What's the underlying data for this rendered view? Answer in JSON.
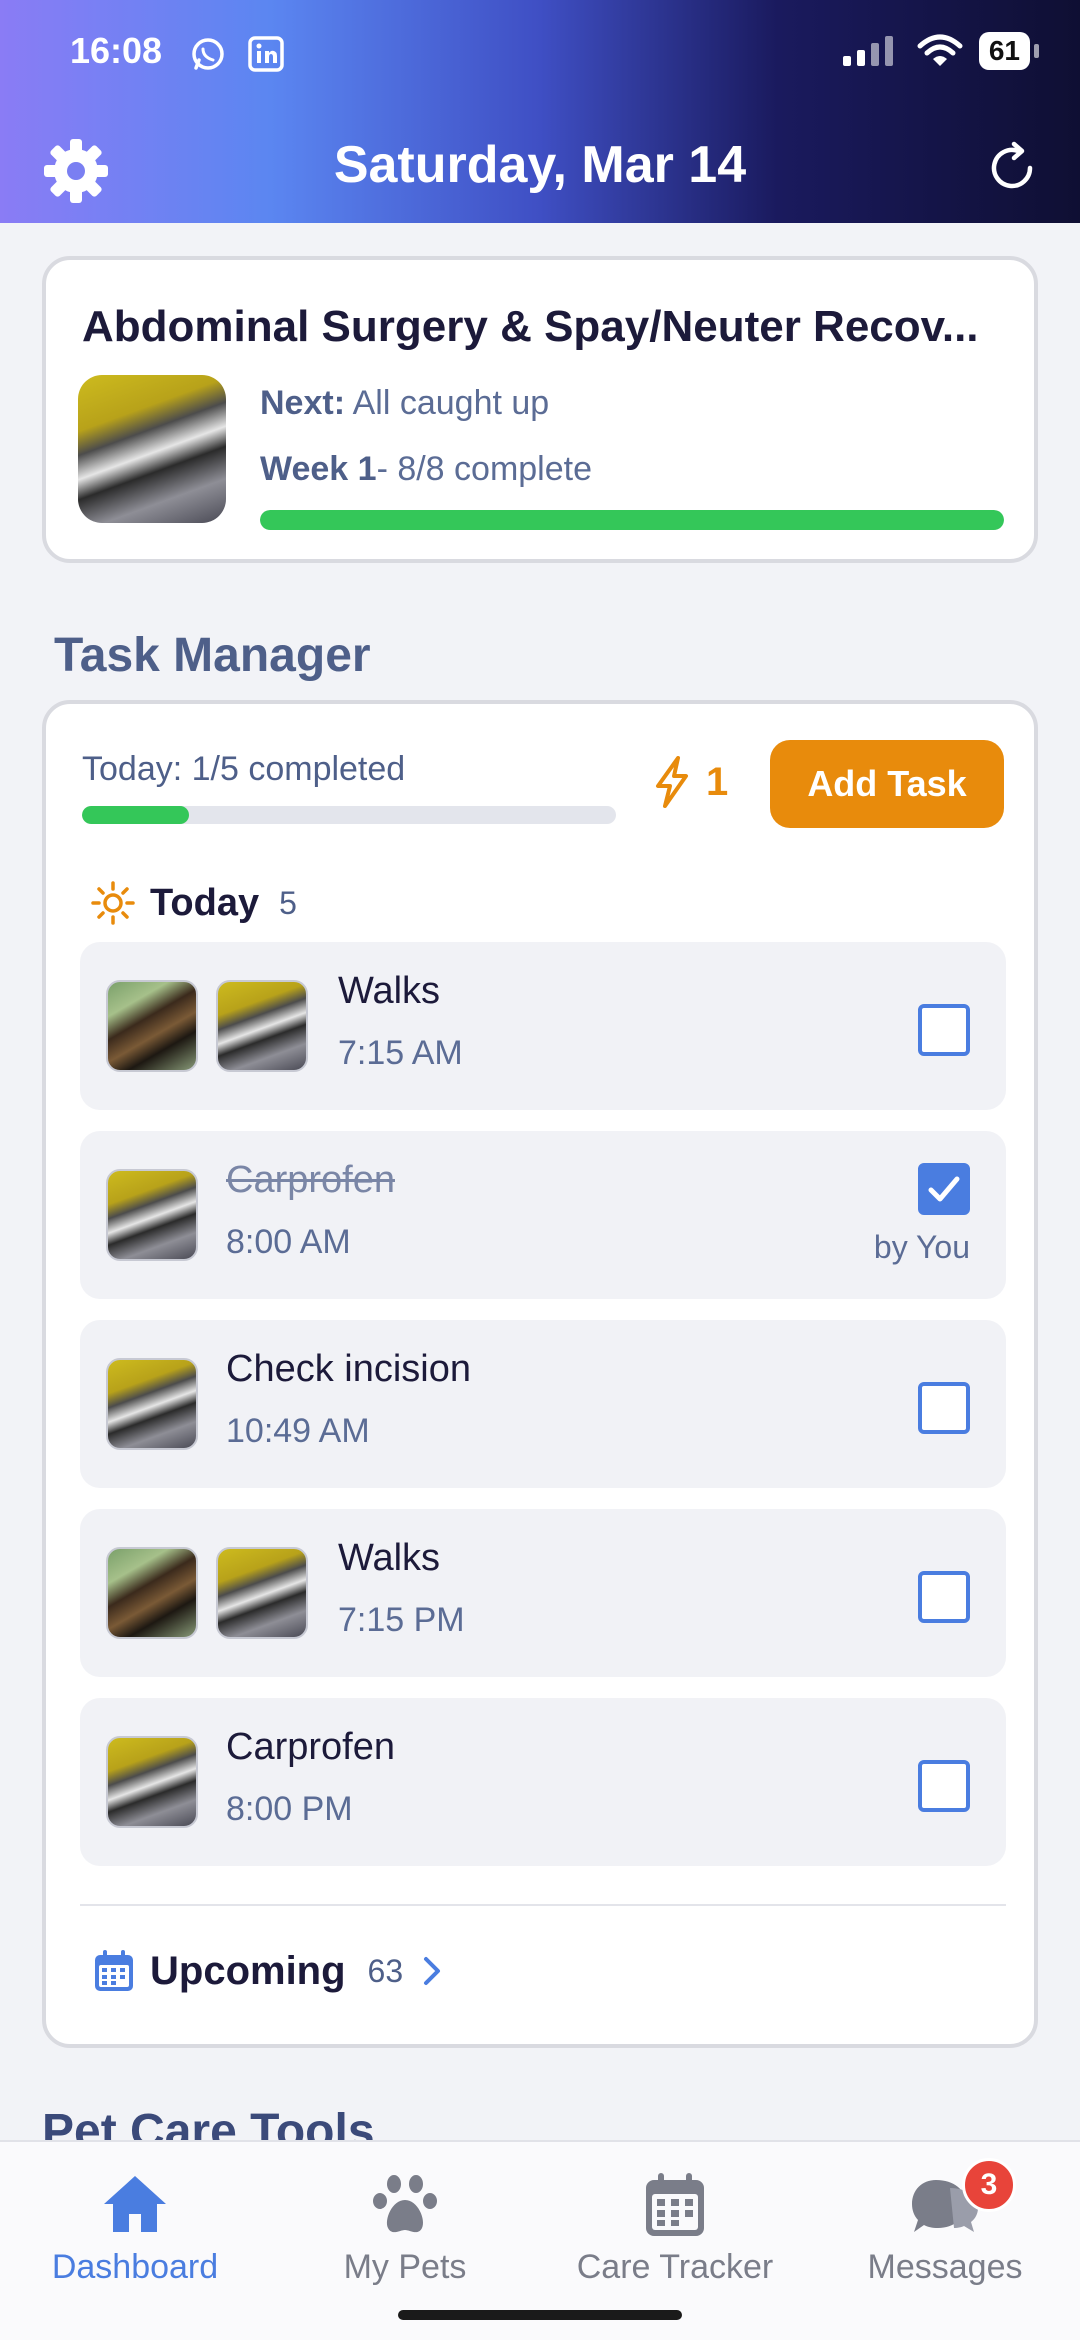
{
  "status_bar": {
    "time": "16:08",
    "battery": "61"
  },
  "header": {
    "title": "Saturday, Mar 14"
  },
  "plan": {
    "title": "Abdominal Surgery & Spay/Neuter Recov...",
    "next_label": "Next:",
    "next_value": "All caught up",
    "week_label": "Week 1",
    "week_value": "- 8/8 complete",
    "progress": 1.0,
    "progress_color": "#34c759"
  },
  "task_manager": {
    "title": "Task Manager",
    "summary": "Today: 1/5 completed",
    "progress": 0.2,
    "streak": "1",
    "add_task_label": "Add Task",
    "today_group": {
      "title": "Today",
      "count": "5"
    },
    "tasks": [
      {
        "name": "Walks",
        "time": "7:15 AM",
        "done": false
      },
      {
        "name": "Carprofen",
        "time": "8:00 AM",
        "done": true,
        "done_by": "by You"
      },
      {
        "name": "Check incision",
        "time": "10:49 AM",
        "done": false
      },
      {
        "name": "Walks",
        "time": "7:15 PM",
        "done": false
      },
      {
        "name": "Carprofen",
        "time": "8:00 PM",
        "done": false
      }
    ],
    "upcoming": {
      "title": "Upcoming",
      "count": "63"
    }
  },
  "next_section": {
    "title": "Pet Care Tools"
  },
  "nav": {
    "items": [
      {
        "label": "Dashboard",
        "icon": "home-icon",
        "active": true
      },
      {
        "label": "My Pets",
        "icon": "paw-icon",
        "active": false
      },
      {
        "label": "Care Tracker",
        "icon": "calendar-icon",
        "active": false
      },
      {
        "label": "Messages",
        "icon": "chat-icon",
        "active": false,
        "badge": "3"
      }
    ]
  },
  "colors": {
    "accent": "#4a7de0",
    "orange": "#e88b0c",
    "green": "#34c759"
  }
}
